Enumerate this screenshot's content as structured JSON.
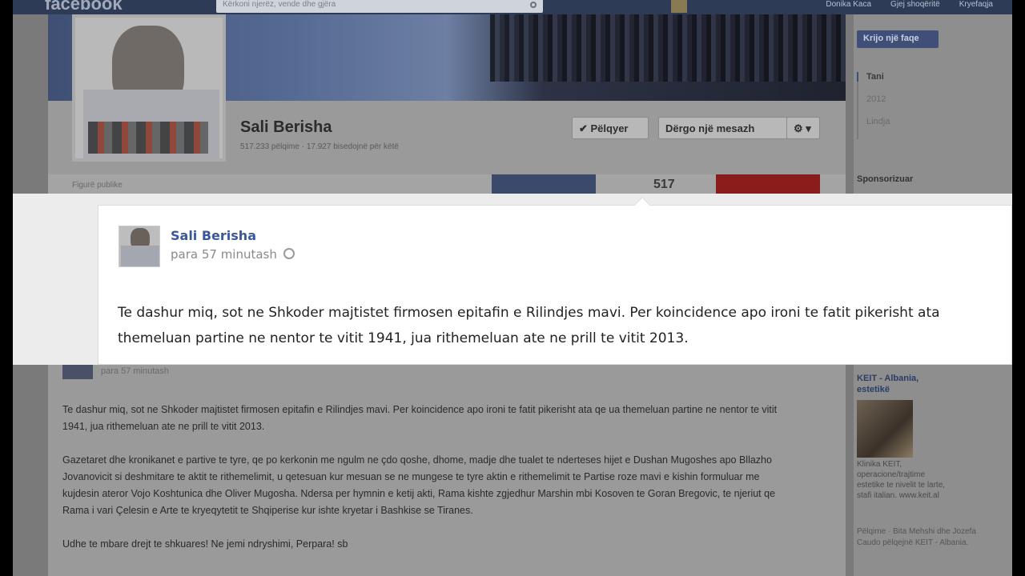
{
  "topbar": {
    "logo": "facebook",
    "search_placeholder": "Kërkoni njerëz, vende dhe gjëra",
    "links": [
      "Donika Kaca",
      "Gjej shoqëritë",
      "Kryefaqja"
    ]
  },
  "profile": {
    "name": "Sali Berisha",
    "subtitle": "517.233 pëlqime · 17.927 bisedojnë për këtë",
    "like_button": "✔ Pëlqyer",
    "message_button": "Dërgo një mesazh",
    "gear_button": "⚙ ▾",
    "category": "Figurë publike",
    "likes_count": "517"
  },
  "right": {
    "create_page": "Krijo një faqe",
    "timeline": [
      "Tani",
      "2012",
      "Lindja"
    ],
    "sponsored": "Sponsorizuar",
    "ad_title": "KEIT - Albania, estetikë",
    "ad_text": "Klinika KEIT, operacione/trajtime estetike te nivelit te larte, stafi italian. www.keit.al",
    "ad_footer": "Pëlqime · Bita Mehshi dhe Jozefa Caudo pëlqejnë KEIT - Albania."
  },
  "background_post": {
    "time": "para 57 minutash",
    "paragraphs": [
      "Te dashur miq, sot ne Shkoder majtistet firmosen epitafin e Rilindjes mavi. Per koincidence apo ironi te fatit pikerisht ata qe ua themeluan partine ne nentor te vitit 1941, jua rithemeluan ate ne prill te vitit 2013.",
      "Gazetaret dhe kronikanet e partive te tyre, qe po kerkonin me ngulm ne çdo qoshe, dhome, madje dhe tualet te nderteses hijet e Dushan Mugoshes apo Bllazho Jovanovicit si deshmitare te aktit te rithemelimit, u qetesuan kur mesuan se ne mungese te tyre aktin e rithemelimit te Partise roze mavi e kishin formuluar me kujdesin ateror Vojo Koshtunica dhe Oliver Mugosha. Ndersa per hymnin e ketij akti, Rama kishte zgjedhur Marshin mbi Kosoven te Goran Bregovic, te njeriut qe Rama i vari Çelesin e Arte te kryeqytetit te Shqiperise kur ishte kryetar i Bashkise se Tiranes.",
      "Udhe te mbare drejt te shkuares! Ne jemi ndryshimi, Perpara! sb"
    ]
  },
  "highlight": {
    "author": "Sali Berisha",
    "timestamp": "para 57 minutash",
    "line1": "Te dashur miq, sot ne Shkoder majtistet firmosen epitafin e Rilindjes mavi. Per koincidence apo ironi te fatit pikerisht ata",
    "line2": "themeluan partine ne nentor te vitit 1941, jua rithemeluan ate ne prill te vitit 2013."
  },
  "colors": {
    "facebook_blue": "#3b5998",
    "topbar": "#2d3b57"
  }
}
